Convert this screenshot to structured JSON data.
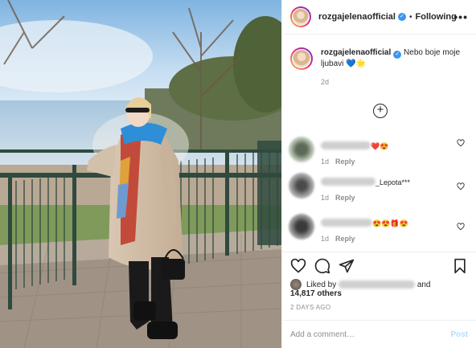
{
  "header": {
    "username": "rozgajelenaofficial",
    "separator": "•",
    "follow_status": "Following",
    "more_label": "•••"
  },
  "caption": {
    "username": "rozgajelenaofficial",
    "text": "Nebo boje moje ljubavi 💙🌟",
    "time": "2d"
  },
  "load_more_label": "+",
  "comments": [
    {
      "text_suffix": "❤️😍",
      "time": "1d",
      "reply_label": "Reply"
    },
    {
      "text_suffix": "_Lepota***",
      "time": "1d",
      "reply_label": "Reply"
    },
    {
      "text_suffix": "😍😍🎁😍",
      "time": "1d",
      "reply_label": "Reply"
    }
  ],
  "likes": {
    "prefix": "Liked by",
    "suffix": "and",
    "count_text": "14,817 others"
  },
  "timestamp": "2 DAYS AGO",
  "add_comment": {
    "placeholder": "Add a comment…",
    "post_label": "Post"
  },
  "icons": {
    "verified": "verified-badge-icon",
    "heart": "heart-icon",
    "comment": "comment-icon",
    "share": "share-icon",
    "bookmark": "bookmark-icon",
    "plus": "plus-circle-icon"
  },
  "colors": {
    "verified_blue": "#3897f0",
    "post_button": "#b2dffc",
    "muted_text": "#8e8e8e"
  }
}
